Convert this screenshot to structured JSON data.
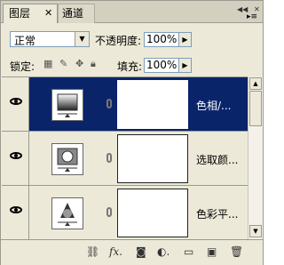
{
  "tabs": [
    {
      "label": "图层",
      "active": true
    },
    {
      "label": "通道",
      "active": false
    }
  ],
  "blend_mode": "正常",
  "opacity_label": "不透明度:",
  "opacity_value": "100%",
  "lock_label": "锁定:",
  "fill_label": "填充:",
  "fill_value": "100%",
  "layers": [
    {
      "name": "色相/...",
      "selected": true,
      "adjustment_icon": "hue-saturation-icon"
    },
    {
      "name": "选取颜...",
      "selected": false,
      "adjustment_icon": "selective-color-icon"
    },
    {
      "name": "色彩平...",
      "selected": false,
      "adjustment_icon": "color-balance-icon"
    }
  ],
  "colors": {
    "selection": "#0a246a",
    "panel": "#ece9d8"
  }
}
